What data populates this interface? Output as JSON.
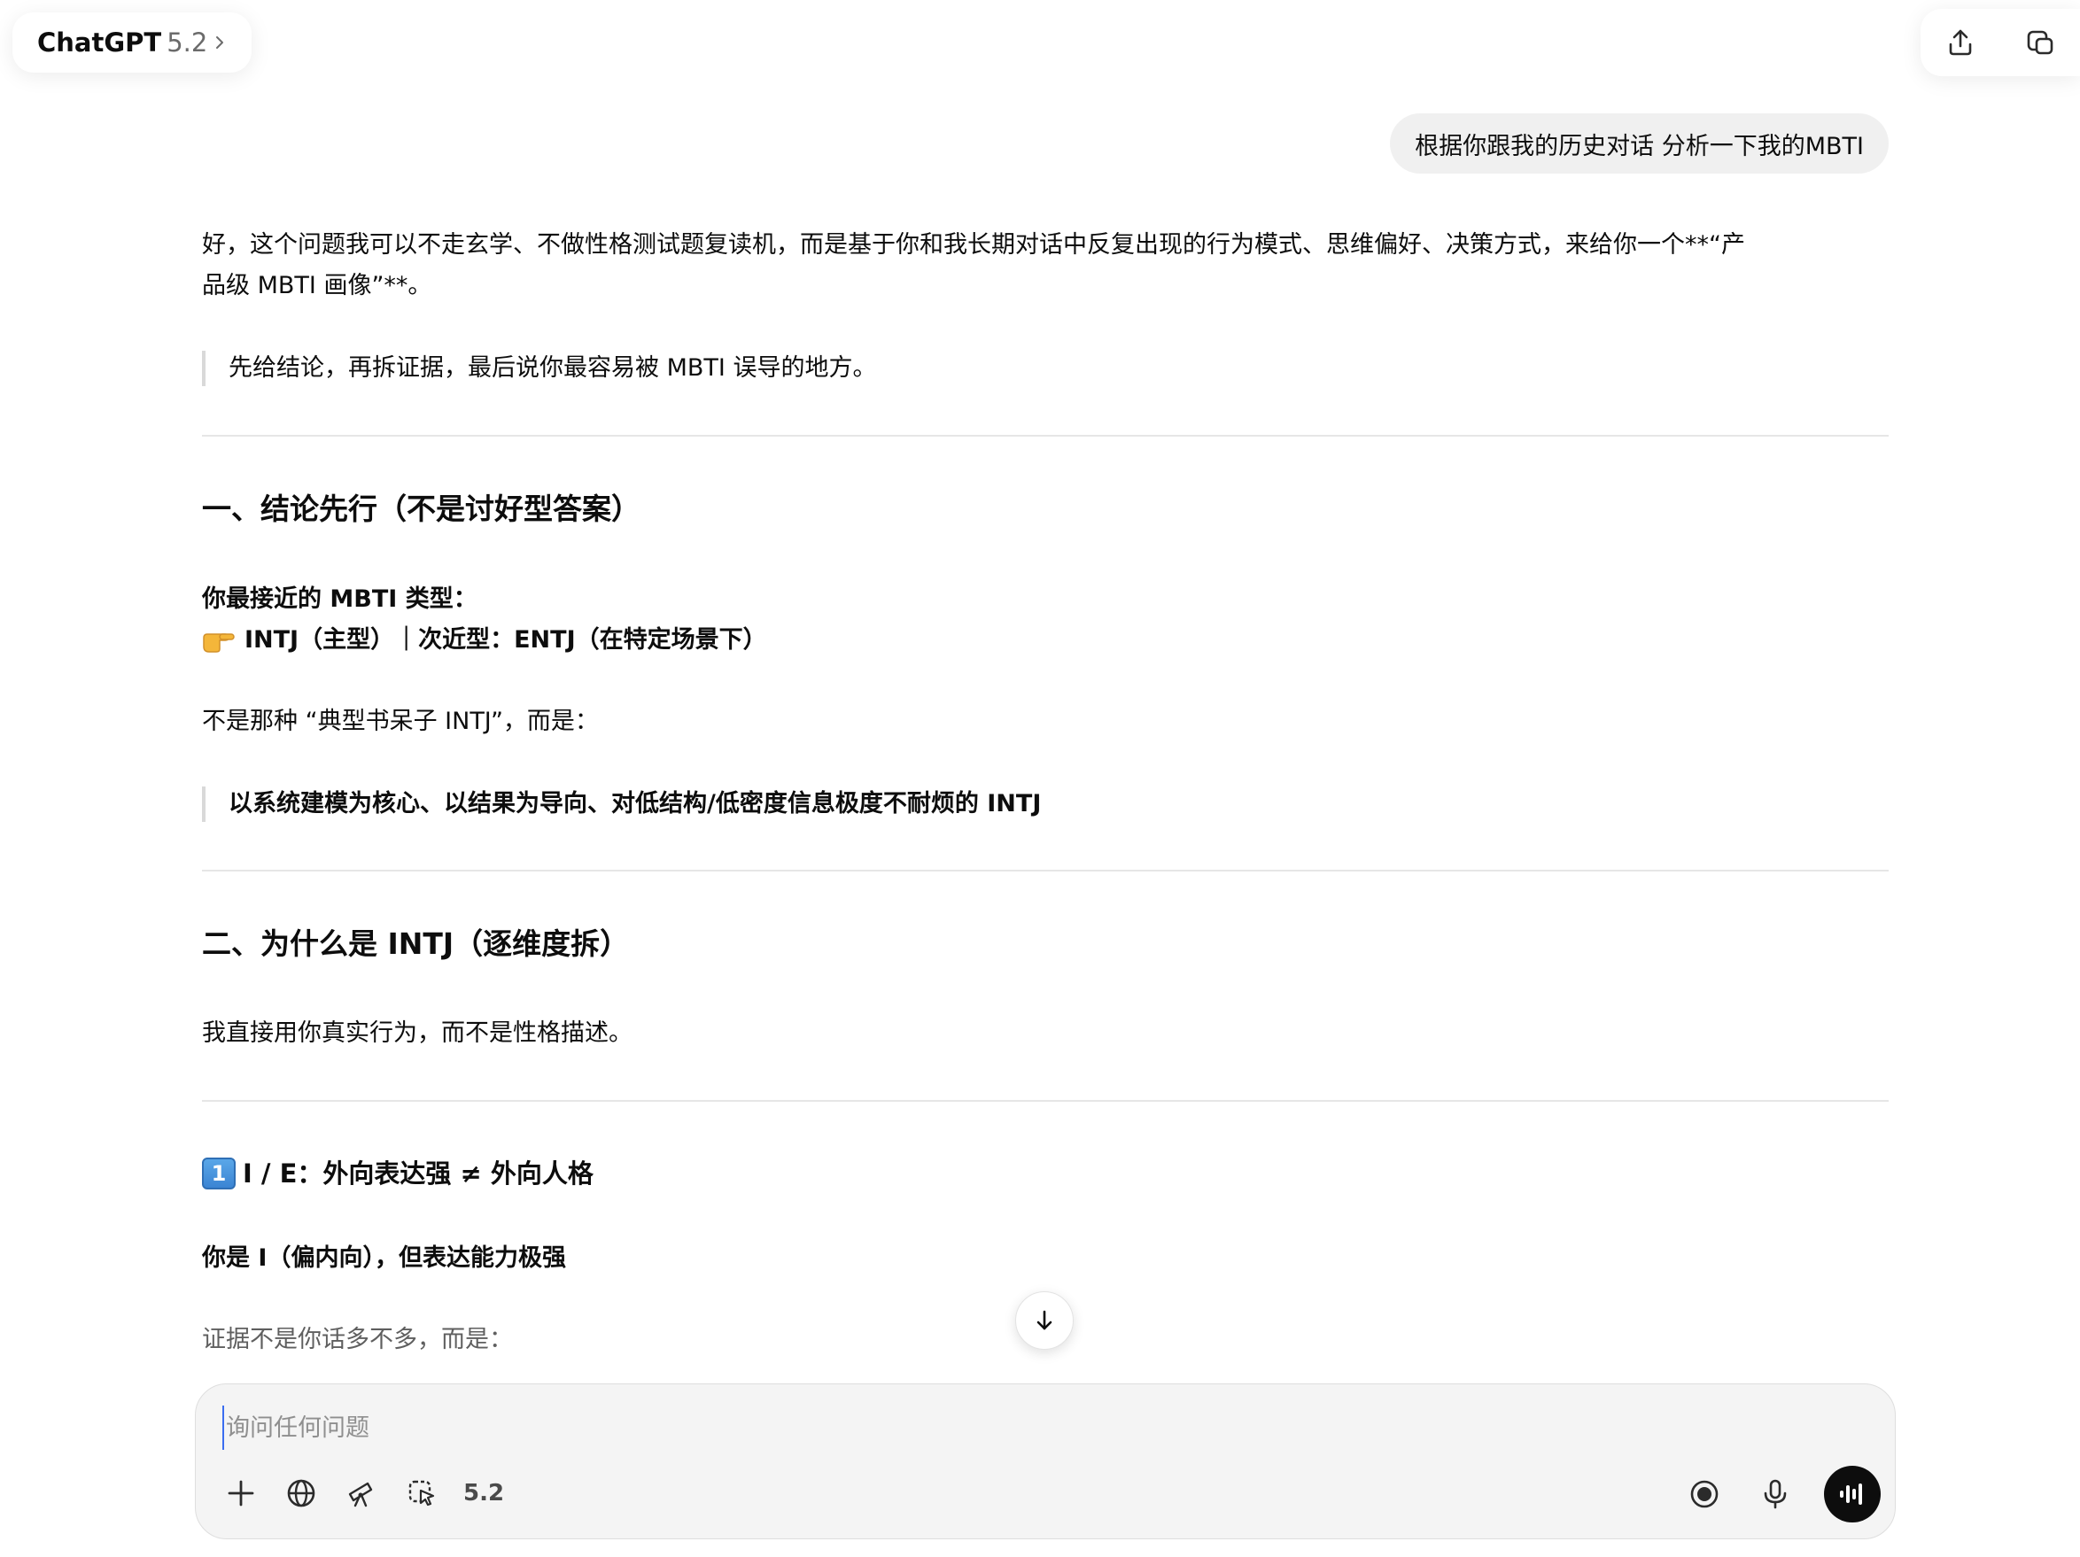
{
  "header": {
    "app_name": "ChatGPT",
    "model_version": "5.2",
    "share_icon": "share-icon",
    "new_window_icon": "new-chat-window-icon"
  },
  "user_message": "根据你跟我的历史对话 分析一下我的MBTI",
  "assistant": {
    "intro_line1": "好，这个问题我可以不走玄学、不做性格测试题复读机，而是基于你和我长期对话中反复出现的行为模式、思维偏好、决策方式，来给你一个**“产",
    "intro_line2": "品级 MBTI 画像”**。",
    "quote1": "先给结论，再拆证据，最后说你最容易被 MBTI 误导的地方。",
    "section1_title": "一、结论先行（不是讨好型答案）",
    "closest_type_label": "你最接近的 MBTI 类型：",
    "type_line": "INTJ（主型）｜次近型：ENTJ（在特定场景下）",
    "not_typical": "不是那种 “典型书呆子 INTJ”，而是：",
    "quote2": "以系统建模为核心、以结果为导向、对低结构/低密度信息极度不耐烦的 INTJ",
    "section2_title": "二、为什么是 INTJ（逐维度拆）",
    "section2_intro": "我直接用你真实行为，而不是性格描述。",
    "ie_title": "I / E：外向表达强 ≠ 外向人格",
    "ie_keycap": "1",
    "ie_bold": "你是 I（偏内向），但表达能力极强",
    "evidence_line": "证据不是你话多不多，而是："
  },
  "composer": {
    "placeholder": "询问任何问题",
    "value": "",
    "model_chip": "5.2"
  },
  "colors": {
    "bubble_bg": "#f0f0f0",
    "composer_bg": "#f4f4f4",
    "divider": "#e6e6e6",
    "voice_btn": "#0d0d0d"
  }
}
